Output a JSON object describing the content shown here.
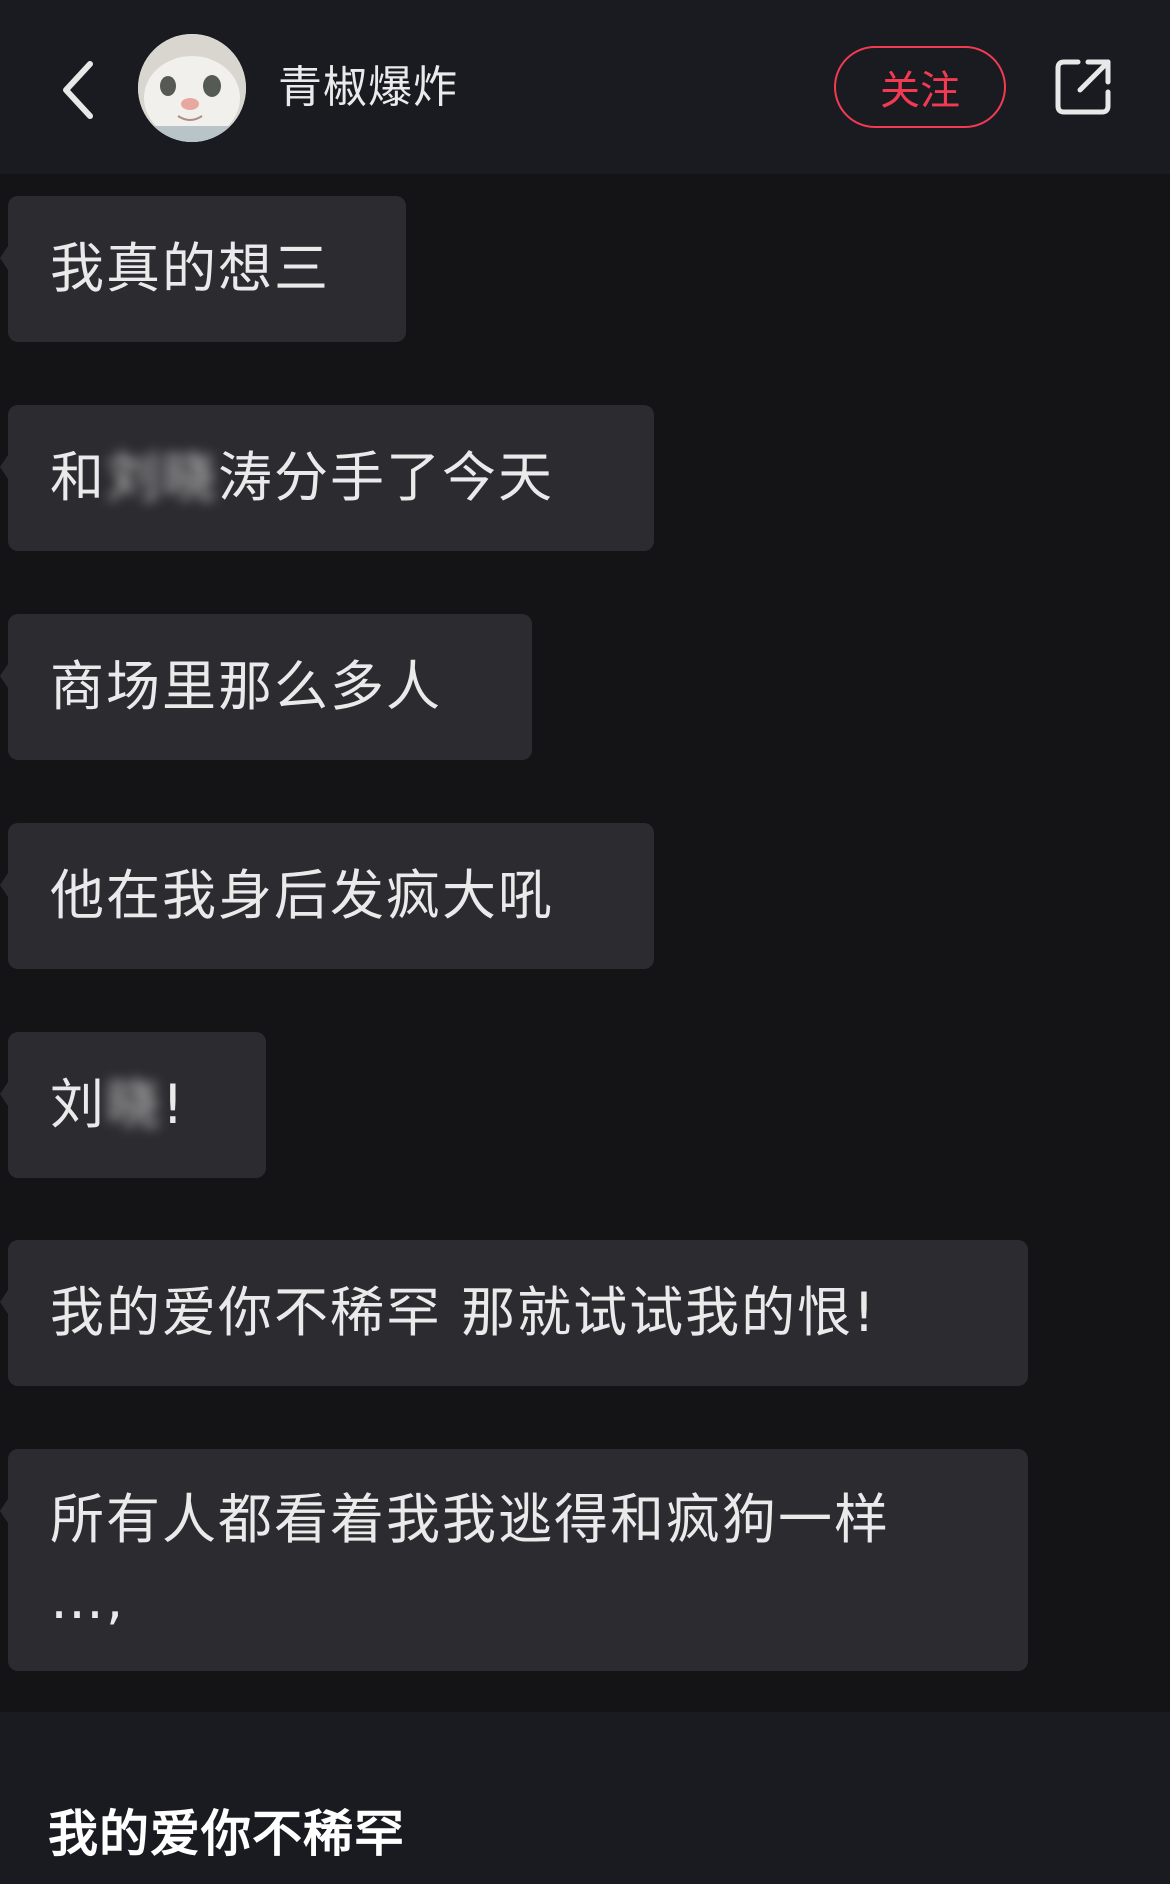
{
  "header": {
    "username": "青椒爆炸",
    "follow_label": "关注",
    "back_icon": "chevron-left-icon",
    "share_icon": "share-external-icon",
    "follow_color": "#f23b52"
  },
  "messages": [
    {
      "text": "我真的想三"
    },
    {
      "prefix": "和",
      "blurred": "刘晓",
      "suffix": "涛分手了今天"
    },
    {
      "text": "商场里那么多人"
    },
    {
      "text": "他在我身后发疯大吼"
    },
    {
      "prefix": "刘",
      "blurred": "晓",
      "suffix": "!"
    },
    {
      "text": "我的爱你不稀罕 那就试试我的恨!"
    },
    {
      "line1": "所有人都看着我我逃得和疯狗一样",
      "line2": "…,"
    }
  ],
  "footer": {
    "title": "我的爱你不稀罕"
  }
}
